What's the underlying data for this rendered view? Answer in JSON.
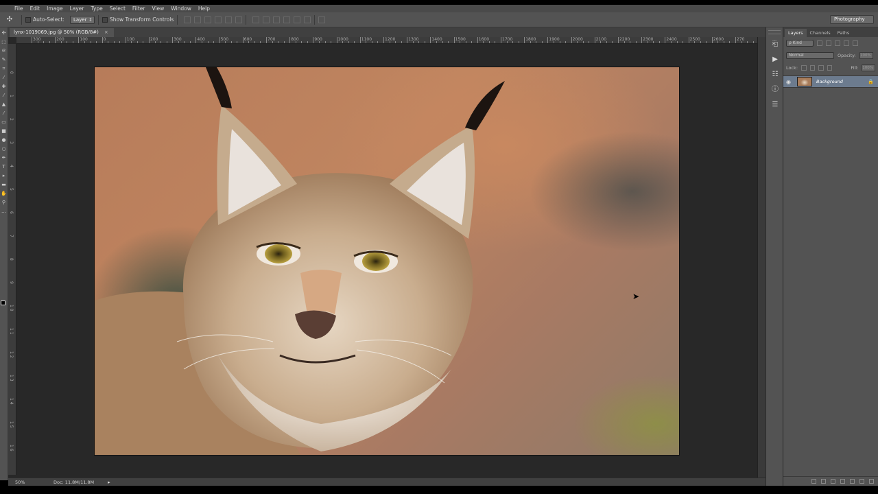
{
  "menu": [
    "File",
    "Edit",
    "Image",
    "Layer",
    "Type",
    "Select",
    "Filter",
    "View",
    "Window",
    "Help"
  ],
  "options": {
    "tool_icon": "move-tool-icon",
    "auto_select_label": "Auto-Select:",
    "auto_select_value": "Layer",
    "transform_label": "Show Transform Controls"
  },
  "workspace": "Photography",
  "document": {
    "tab_title": "lynx-1019069.jpg @ 50% (RGB/8#)",
    "close": "×",
    "zoom": "50%",
    "doc_info": "Doc: 11.8M/11.8M"
  },
  "ruler": {
    "h_labels": [
      "300",
      "200",
      "100",
      "0",
      "100",
      "200",
      "300",
      "400",
      "500",
      "600",
      "700",
      "800",
      "900",
      "1000",
      "1100",
      "1200",
      "1300",
      "1400",
      "1500",
      "1600",
      "1700",
      "1800",
      "1900",
      "2000",
      "2100",
      "2200",
      "2300",
      "2400",
      "2500",
      "2600",
      "270",
      "28"
    ],
    "v_labels": [
      "0",
      "1",
      "2",
      "3",
      "4",
      "5",
      "6",
      "7",
      "8",
      "9",
      "1 0",
      "1 1",
      "1 2",
      "1 3",
      "1 4",
      "1 5",
      "1 6"
    ]
  },
  "panel": {
    "tabs": [
      "Layers",
      "Channels",
      "Paths"
    ],
    "active_tab": "Layers",
    "kind_label": "ρ Kind",
    "blend_mode": "Normal",
    "opacity_label": "Opacity:",
    "opacity_value": "100%",
    "lock_label": "Lock:",
    "fill_label": "Fill:",
    "fill_value": "100%",
    "layers": [
      {
        "name": "Background",
        "visible": true,
        "locked": true
      }
    ]
  },
  "colors": {
    "ui_dark": "#282828",
    "ui_mid": "#535353",
    "layer_selected": "#6c7b8e"
  }
}
